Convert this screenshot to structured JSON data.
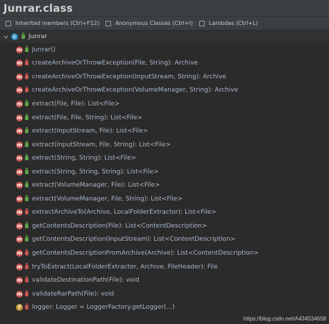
{
  "window": {
    "title": "Junrar.class"
  },
  "toolbar": {
    "inherited_label": "Inherited members (Ctrl+F12)",
    "anonymous_label": "Anonymous Classes (Ctrl+I)",
    "lambdas_label": "Lambdas (Ctrl+L)"
  },
  "tree": {
    "root_label": "Junrar",
    "members": [
      {
        "label": "Junrar()",
        "kind": "method",
        "visibility": "public"
      },
      {
        "label": "createArchiveOrThrowException(File, String): Archive",
        "kind": "method",
        "visibility": "private"
      },
      {
        "label": "createArchiveOrThrowException(InputStream, String): Archive",
        "kind": "method",
        "visibility": "private"
      },
      {
        "label": "createArchiveOrThrowException(VolumeManager, String): Archive",
        "kind": "method",
        "visibility": "private"
      },
      {
        "label": "extract(File, File): List<File>",
        "kind": "method",
        "visibility": "public"
      },
      {
        "label": "extract(File, File, String): List<File>",
        "kind": "method",
        "visibility": "public"
      },
      {
        "label": "extract(InputStream, File): List<File>",
        "kind": "method",
        "visibility": "public"
      },
      {
        "label": "extract(InputStream, File, String): List<File>",
        "kind": "method",
        "visibility": "public"
      },
      {
        "label": "extract(String, String): List<File>",
        "kind": "method",
        "visibility": "public"
      },
      {
        "label": "extract(String, String, String): List<File>",
        "kind": "method",
        "visibility": "public"
      },
      {
        "label": "extract(VolumeManager, File): List<File>",
        "kind": "method",
        "visibility": "public"
      },
      {
        "label": "extract(VolumeManager, File, String): List<File>",
        "kind": "method",
        "visibility": "public"
      },
      {
        "label": "extractArchiveTo(Archive, LocalFolderExtractor): List<File>",
        "kind": "method",
        "visibility": "private"
      },
      {
        "label": "getContentsDescription(File): List<ContentDescription>",
        "kind": "method",
        "visibility": "public"
      },
      {
        "label": "getContentsDescription(InputStream): List<ContentDescription>",
        "kind": "method",
        "visibility": "public"
      },
      {
        "label": "getContentsDescriptionFromArchive(Archive): List<ContentDescription>",
        "kind": "method",
        "visibility": "private"
      },
      {
        "label": "tryToExtract(LocalFolderExtractor, Archive, FileHeader): File",
        "kind": "method",
        "visibility": "private"
      },
      {
        "label": "validateDestinationPath(File): void",
        "kind": "method",
        "visibility": "private"
      },
      {
        "label": "validateRarPath(File): void",
        "kind": "method",
        "visibility": "private"
      },
      {
        "label": "logger: Logger = LoggerFactory.getLogger(...)",
        "kind": "field",
        "visibility": "private"
      }
    ]
  },
  "watermark": "https://blog.csdn.net/A434534658",
  "colors": {
    "method_icon": "#c75450",
    "field_icon": "#c99a3a",
    "class_icon": "#3592c4",
    "public": "#5fa046",
    "private": "#c75450"
  }
}
